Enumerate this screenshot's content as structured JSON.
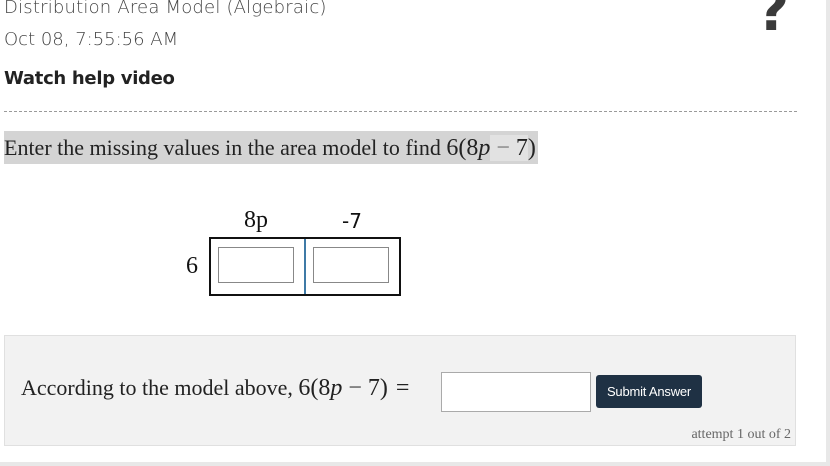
{
  "header": {
    "title": "Distribution Area Model (Algebraic)",
    "timestamp": "Oct 08, 7:55:56 AM",
    "help_link": "Watch help video",
    "help_icon": "?"
  },
  "problem": {
    "prompt_text": "Enter the missing values in the area model to find ",
    "expression": {
      "coef": "6",
      "open": "(",
      "term1_coef": "8",
      "term1_var": "p",
      "minus": "−",
      "term2": "7",
      "close": ")"
    }
  },
  "area_model": {
    "column_labels": [
      "8p",
      "-7"
    ],
    "row_label": "6",
    "cells": [
      {
        "value": ""
      },
      {
        "value": ""
      }
    ]
  },
  "answer": {
    "lead_text": "According to the model above, ",
    "equals": "=",
    "input_value": "",
    "submit_label": "Submit Answer",
    "attempt_text": "attempt 1 out of 2"
  }
}
